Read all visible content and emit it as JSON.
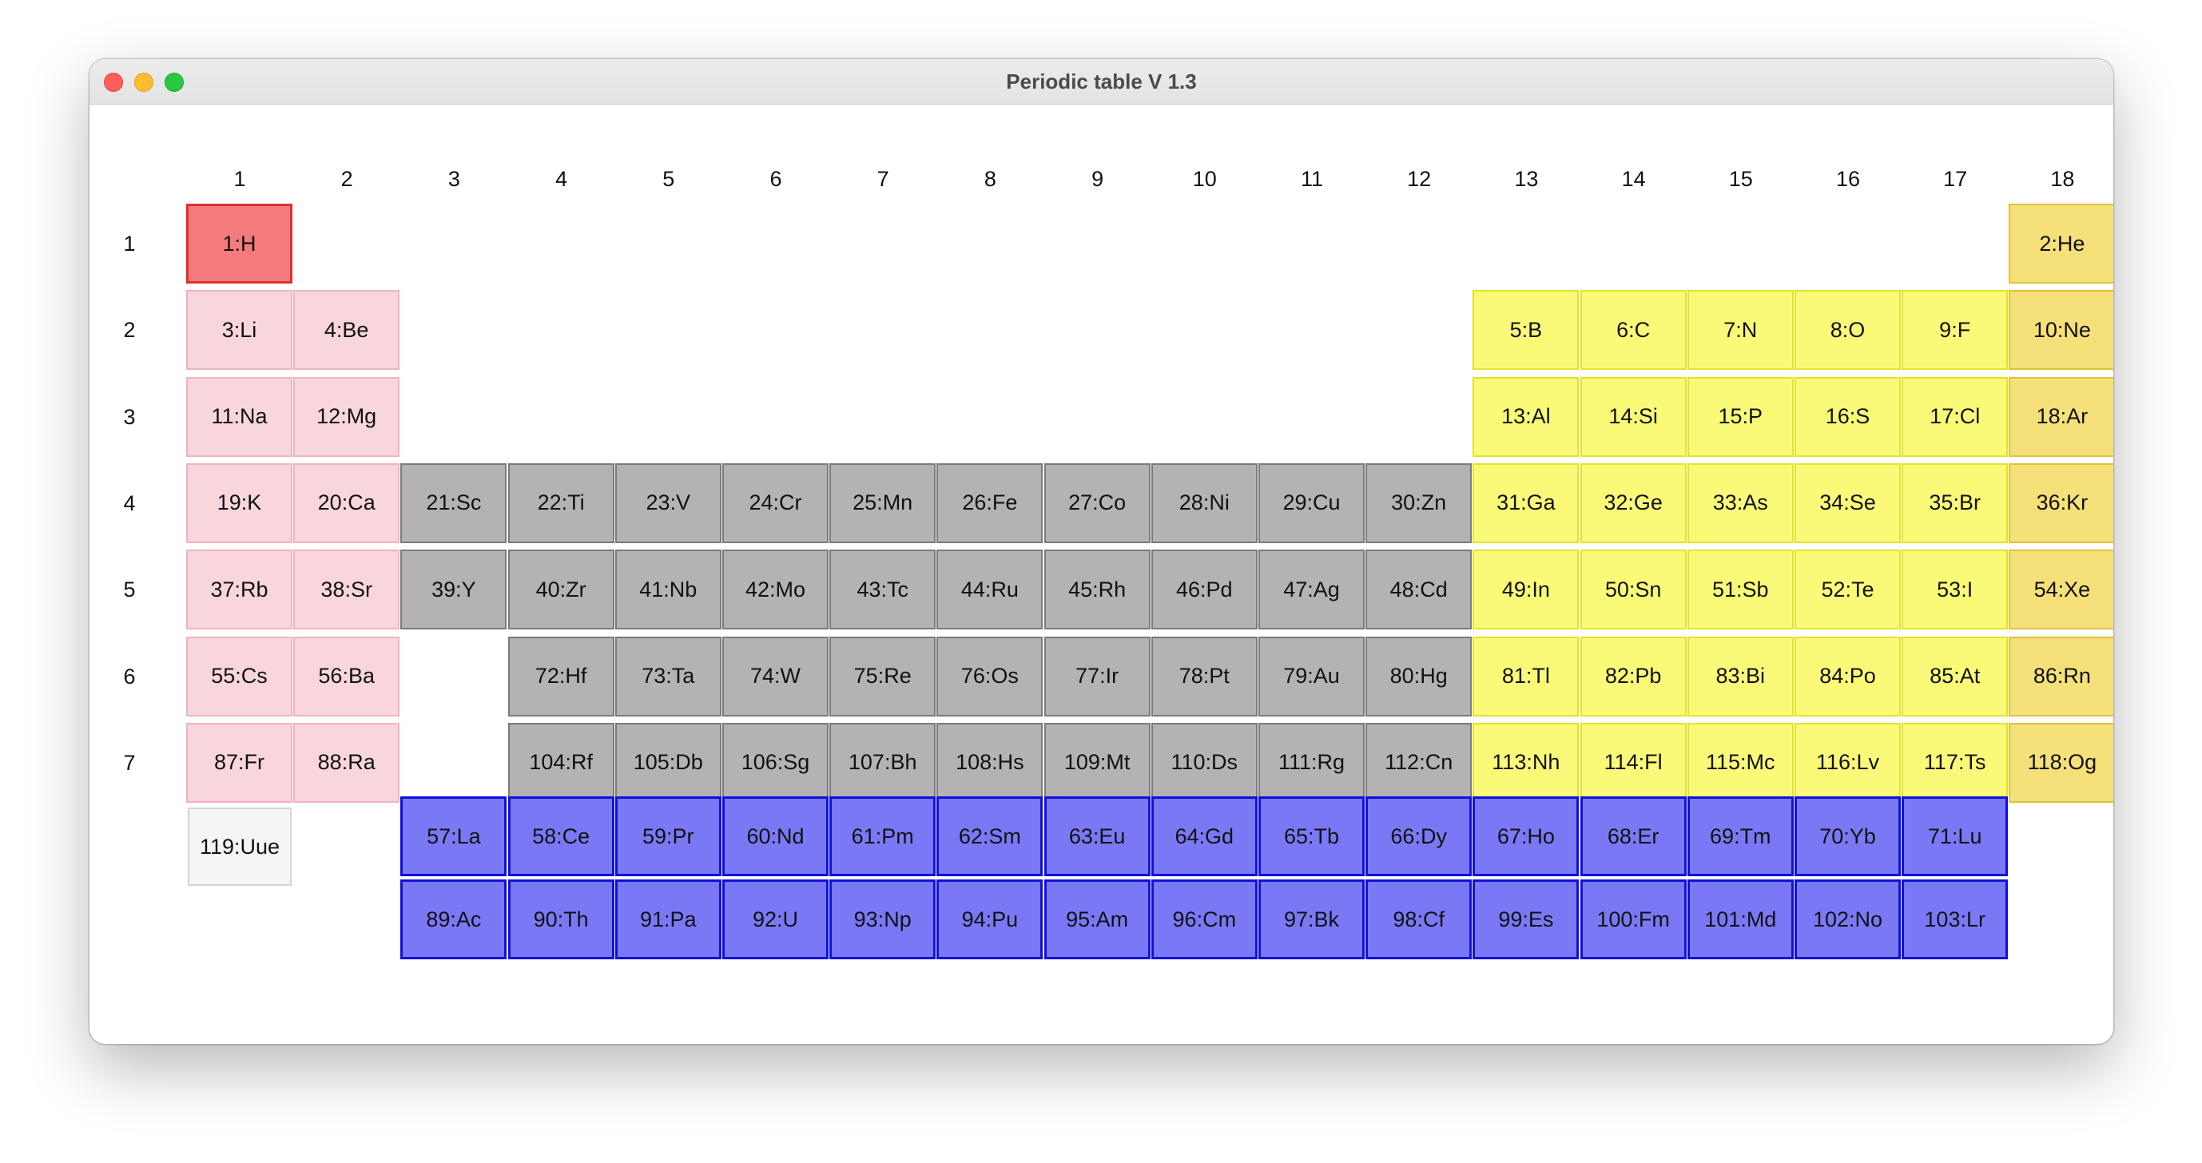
{
  "window": {
    "title": "Periodic table V 1.3"
  },
  "colors": {
    "hydrogen": {
      "bg": "#f47b7b",
      "border": "#e03030"
    },
    "alkali": {
      "bg": "#f9d5dc",
      "border": "#f0b4bf"
    },
    "transition": {
      "bg": "#b3b3b3",
      "border": "#7a7a7a"
    },
    "pblock": {
      "bg": "#fafa78",
      "border": "#e3e32a"
    },
    "noble": {
      "bg": "#f5e07a",
      "border": "#e0c23a"
    },
    "fblock": {
      "bg": "#7a78f5",
      "border": "#1010d8"
    },
    "unknown": {
      "bg": "#f5f5f5",
      "border": "#d5d5d5"
    }
  },
  "columns": [
    "1",
    "2",
    "3",
    "4",
    "5",
    "6",
    "7",
    "8",
    "9",
    "10",
    "11",
    "12",
    "13",
    "14",
    "15",
    "16",
    "17",
    "18"
  ],
  "periods": [
    "1",
    "2",
    "3",
    "4",
    "5",
    "6",
    "7"
  ],
  "elements": [
    {
      "label": "1:H",
      "row": 1,
      "col": 1,
      "cat": "hydrogen"
    },
    {
      "label": "2:He",
      "row": 1,
      "col": 18,
      "cat": "noble"
    },
    {
      "label": "3:Li",
      "row": 2,
      "col": 1,
      "cat": "alkali"
    },
    {
      "label": "4:Be",
      "row": 2,
      "col": 2,
      "cat": "alkali"
    },
    {
      "label": "5:B",
      "row": 2,
      "col": 13,
      "cat": "pblock"
    },
    {
      "label": "6:C",
      "row": 2,
      "col": 14,
      "cat": "pblock"
    },
    {
      "label": "7:N",
      "row": 2,
      "col": 15,
      "cat": "pblock"
    },
    {
      "label": "8:O",
      "row": 2,
      "col": 16,
      "cat": "pblock"
    },
    {
      "label": "9:F",
      "row": 2,
      "col": 17,
      "cat": "pblock"
    },
    {
      "label": "10:Ne",
      "row": 2,
      "col": 18,
      "cat": "noble"
    },
    {
      "label": "11:Na",
      "row": 3,
      "col": 1,
      "cat": "alkali"
    },
    {
      "label": "12:Mg",
      "row": 3,
      "col": 2,
      "cat": "alkali"
    },
    {
      "label": "13:Al",
      "row": 3,
      "col": 13,
      "cat": "pblock"
    },
    {
      "label": "14:Si",
      "row": 3,
      "col": 14,
      "cat": "pblock"
    },
    {
      "label": "15:P",
      "row": 3,
      "col": 15,
      "cat": "pblock"
    },
    {
      "label": "16:S",
      "row": 3,
      "col": 16,
      "cat": "pblock"
    },
    {
      "label": "17:Cl",
      "row": 3,
      "col": 17,
      "cat": "pblock"
    },
    {
      "label": "18:Ar",
      "row": 3,
      "col": 18,
      "cat": "noble"
    },
    {
      "label": "19:K",
      "row": 4,
      "col": 1,
      "cat": "alkali"
    },
    {
      "label": "20:Ca",
      "row": 4,
      "col": 2,
      "cat": "alkali"
    },
    {
      "label": "21:Sc",
      "row": 4,
      "col": 3,
      "cat": "transition"
    },
    {
      "label": "22:Ti",
      "row": 4,
      "col": 4,
      "cat": "transition"
    },
    {
      "label": "23:V",
      "row": 4,
      "col": 5,
      "cat": "transition"
    },
    {
      "label": "24:Cr",
      "row": 4,
      "col": 6,
      "cat": "transition"
    },
    {
      "label": "25:Mn",
      "row": 4,
      "col": 7,
      "cat": "transition"
    },
    {
      "label": "26:Fe",
      "row": 4,
      "col": 8,
      "cat": "transition"
    },
    {
      "label": "27:Co",
      "row": 4,
      "col": 9,
      "cat": "transition"
    },
    {
      "label": "28:Ni",
      "row": 4,
      "col": 10,
      "cat": "transition"
    },
    {
      "label": "29:Cu",
      "row": 4,
      "col": 11,
      "cat": "transition"
    },
    {
      "label": "30:Zn",
      "row": 4,
      "col": 12,
      "cat": "transition"
    },
    {
      "label": "31:Ga",
      "row": 4,
      "col": 13,
      "cat": "pblock"
    },
    {
      "label": "32:Ge",
      "row": 4,
      "col": 14,
      "cat": "pblock"
    },
    {
      "label": "33:As",
      "row": 4,
      "col": 15,
      "cat": "pblock"
    },
    {
      "label": "34:Se",
      "row": 4,
      "col": 16,
      "cat": "pblock"
    },
    {
      "label": "35:Br",
      "row": 4,
      "col": 17,
      "cat": "pblock"
    },
    {
      "label": "36:Kr",
      "row": 4,
      "col": 18,
      "cat": "noble"
    },
    {
      "label": "37:Rb",
      "row": 5,
      "col": 1,
      "cat": "alkali"
    },
    {
      "label": "38:Sr",
      "row": 5,
      "col": 2,
      "cat": "alkali"
    },
    {
      "label": "39:Y",
      "row": 5,
      "col": 3,
      "cat": "transition"
    },
    {
      "label": "40:Zr",
      "row": 5,
      "col": 4,
      "cat": "transition"
    },
    {
      "label": "41:Nb",
      "row": 5,
      "col": 5,
      "cat": "transition"
    },
    {
      "label": "42:Mo",
      "row": 5,
      "col": 6,
      "cat": "transition"
    },
    {
      "label": "43:Tc",
      "row": 5,
      "col": 7,
      "cat": "transition"
    },
    {
      "label": "44:Ru",
      "row": 5,
      "col": 8,
      "cat": "transition"
    },
    {
      "label": "45:Rh",
      "row": 5,
      "col": 9,
      "cat": "transition"
    },
    {
      "label": "46:Pd",
      "row": 5,
      "col": 10,
      "cat": "transition"
    },
    {
      "label": "47:Ag",
      "row": 5,
      "col": 11,
      "cat": "transition"
    },
    {
      "label": "48:Cd",
      "row": 5,
      "col": 12,
      "cat": "transition"
    },
    {
      "label": "49:In",
      "row": 5,
      "col": 13,
      "cat": "pblock"
    },
    {
      "label": "50:Sn",
      "row": 5,
      "col": 14,
      "cat": "pblock"
    },
    {
      "label": "51:Sb",
      "row": 5,
      "col": 15,
      "cat": "pblock"
    },
    {
      "label": "52:Te",
      "row": 5,
      "col": 16,
      "cat": "pblock"
    },
    {
      "label": "53:I",
      "row": 5,
      "col": 17,
      "cat": "pblock"
    },
    {
      "label": "54:Xe",
      "row": 5,
      "col": 18,
      "cat": "noble"
    },
    {
      "label": "55:Cs",
      "row": 6,
      "col": 1,
      "cat": "alkali"
    },
    {
      "label": "56:Ba",
      "row": 6,
      "col": 2,
      "cat": "alkali"
    },
    {
      "label": "72:Hf",
      "row": 6,
      "col": 4,
      "cat": "transition"
    },
    {
      "label": "73:Ta",
      "row": 6,
      "col": 5,
      "cat": "transition"
    },
    {
      "label": "74:W",
      "row": 6,
      "col": 6,
      "cat": "transition"
    },
    {
      "label": "75:Re",
      "row": 6,
      "col": 7,
      "cat": "transition"
    },
    {
      "label": "76:Os",
      "row": 6,
      "col": 8,
      "cat": "transition"
    },
    {
      "label": "77:Ir",
      "row": 6,
      "col": 9,
      "cat": "transition"
    },
    {
      "label": "78:Pt",
      "row": 6,
      "col": 10,
      "cat": "transition"
    },
    {
      "label": "79:Au",
      "row": 6,
      "col": 11,
      "cat": "transition"
    },
    {
      "label": "80:Hg",
      "row": 6,
      "col": 12,
      "cat": "transition"
    },
    {
      "label": "81:Tl",
      "row": 6,
      "col": 13,
      "cat": "pblock"
    },
    {
      "label": "82:Pb",
      "row": 6,
      "col": 14,
      "cat": "pblock"
    },
    {
      "label": "83:Bi",
      "row": 6,
      "col": 15,
      "cat": "pblock"
    },
    {
      "label": "84:Po",
      "row": 6,
      "col": 16,
      "cat": "pblock"
    },
    {
      "label": "85:At",
      "row": 6,
      "col": 17,
      "cat": "pblock"
    },
    {
      "label": "86:Rn",
      "row": 6,
      "col": 18,
      "cat": "noble"
    },
    {
      "label": "87:Fr",
      "row": 7,
      "col": 1,
      "cat": "alkali"
    },
    {
      "label": "88:Ra",
      "row": 7,
      "col": 2,
      "cat": "alkali"
    },
    {
      "label": "104:Rf",
      "row": 7,
      "col": 4,
      "cat": "transition"
    },
    {
      "label": "105:Db",
      "row": 7,
      "col": 5,
      "cat": "transition"
    },
    {
      "label": "106:Sg",
      "row": 7,
      "col": 6,
      "cat": "transition"
    },
    {
      "label": "107:Bh",
      "row": 7,
      "col": 7,
      "cat": "transition"
    },
    {
      "label": "108:Hs",
      "row": 7,
      "col": 8,
      "cat": "transition"
    },
    {
      "label": "109:Mt",
      "row": 7,
      "col": 9,
      "cat": "transition"
    },
    {
      "label": "110:Ds",
      "row": 7,
      "col": 10,
      "cat": "transition"
    },
    {
      "label": "111:Rg",
      "row": 7,
      "col": 11,
      "cat": "transition"
    },
    {
      "label": "112:Cn",
      "row": 7,
      "col": 12,
      "cat": "transition"
    },
    {
      "label": "113:Nh",
      "row": 7,
      "col": 13,
      "cat": "pblock"
    },
    {
      "label": "114:Fl",
      "row": 7,
      "col": 14,
      "cat": "pblock"
    },
    {
      "label": "115:Mc",
      "row": 7,
      "col": 15,
      "cat": "pblock"
    },
    {
      "label": "116:Lv",
      "row": 7,
      "col": 16,
      "cat": "pblock"
    },
    {
      "label": "117:Ts",
      "row": 7,
      "col": 17,
      "cat": "pblock"
    },
    {
      "label": "118:Og",
      "row": 7,
      "col": 18,
      "cat": "noble"
    },
    {
      "label": "119:Uue",
      "row": 8,
      "col": 1,
      "cat": "unknown"
    },
    {
      "label": "57:La",
      "row": 9,
      "col": 3,
      "cat": "fblock"
    },
    {
      "label": "58:Ce",
      "row": 9,
      "col": 4,
      "cat": "fblock"
    },
    {
      "label": "59:Pr",
      "row": 9,
      "col": 5,
      "cat": "fblock"
    },
    {
      "label": "60:Nd",
      "row": 9,
      "col": 6,
      "cat": "fblock"
    },
    {
      "label": "61:Pm",
      "row": 9,
      "col": 7,
      "cat": "fblock"
    },
    {
      "label": "62:Sm",
      "row": 9,
      "col": 8,
      "cat": "fblock"
    },
    {
      "label": "63:Eu",
      "row": 9,
      "col": 9,
      "cat": "fblock"
    },
    {
      "label": "64:Gd",
      "row": 9,
      "col": 10,
      "cat": "fblock"
    },
    {
      "label": "65:Tb",
      "row": 9,
      "col": 11,
      "cat": "fblock"
    },
    {
      "label": "66:Dy",
      "row": 9,
      "col": 12,
      "cat": "fblock"
    },
    {
      "label": "67:Ho",
      "row": 9,
      "col": 13,
      "cat": "fblock"
    },
    {
      "label": "68:Er",
      "row": 9,
      "col": 14,
      "cat": "fblock"
    },
    {
      "label": "69:Tm",
      "row": 9,
      "col": 15,
      "cat": "fblock"
    },
    {
      "label": "70:Yb",
      "row": 9,
      "col": 16,
      "cat": "fblock"
    },
    {
      "label": "71:Lu",
      "row": 9,
      "col": 17,
      "cat": "fblock"
    },
    {
      "label": "89:Ac",
      "row": 10,
      "col": 3,
      "cat": "fblock"
    },
    {
      "label": "90:Th",
      "row": 10,
      "col": 4,
      "cat": "fblock"
    },
    {
      "label": "91:Pa",
      "row": 10,
      "col": 5,
      "cat": "fblock"
    },
    {
      "label": "92:U",
      "row": 10,
      "col": 6,
      "cat": "fblock"
    },
    {
      "label": "93:Np",
      "row": 10,
      "col": 7,
      "cat": "fblock"
    },
    {
      "label": "94:Pu",
      "row": 10,
      "col": 8,
      "cat": "fblock"
    },
    {
      "label": "95:Am",
      "row": 10,
      "col": 9,
      "cat": "fblock"
    },
    {
      "label": "96:Cm",
      "row": 10,
      "col": 10,
      "cat": "fblock"
    },
    {
      "label": "97:Bk",
      "row": 10,
      "col": 11,
      "cat": "fblock"
    },
    {
      "label": "98:Cf",
      "row": 10,
      "col": 12,
      "cat": "fblock"
    },
    {
      "label": "99:Es",
      "row": 10,
      "col": 13,
      "cat": "fblock"
    },
    {
      "label": "100:Fm",
      "row": 10,
      "col": 14,
      "cat": "fblock"
    },
    {
      "label": "101:Md",
      "row": 10,
      "col": 15,
      "cat": "fblock"
    },
    {
      "label": "102:No",
      "row": 10,
      "col": 16,
      "cat": "fblock"
    },
    {
      "label": "103:Lr",
      "row": 10,
      "col": 17,
      "cat": "fblock"
    }
  ]
}
